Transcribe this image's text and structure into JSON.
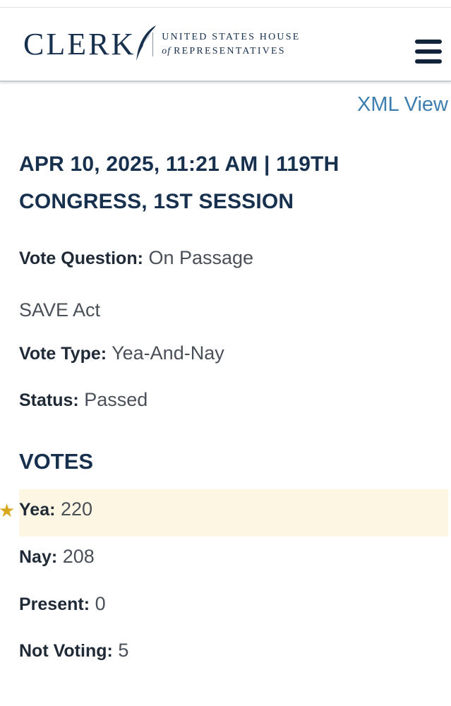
{
  "header": {
    "logo_word": "CLERK",
    "logo_line1": "UNITED STATES HOUSE",
    "logo_of": "of",
    "logo_line2": "REPRESENTATIVES"
  },
  "xml_view_label": "XML View",
  "vote_title": "APR 10, 2025, 11:21 AM | 119TH CONGRESS, 1ST SESSION",
  "vote_question": {
    "label": "Vote Question:",
    "value": "On Passage"
  },
  "bill_title": "SAVE Act",
  "vote_type": {
    "label": "Vote Type:",
    "value": "Yea-And-Nay"
  },
  "status": {
    "label": "Status:",
    "value": "Passed"
  },
  "votes_heading": "VOTES",
  "votes": {
    "yea": {
      "label": "Yea:",
      "value": "220"
    },
    "nay": {
      "label": "Nay:",
      "value": "208"
    },
    "present": {
      "label": "Present:",
      "value": "0"
    },
    "not_voting": {
      "label": "Not Voting:",
      "value": "5"
    }
  },
  "colors": {
    "navy": "#17304e",
    "link": "#3d7eb0",
    "highlight": "#fdf6e3",
    "star": "#d7a81e"
  }
}
